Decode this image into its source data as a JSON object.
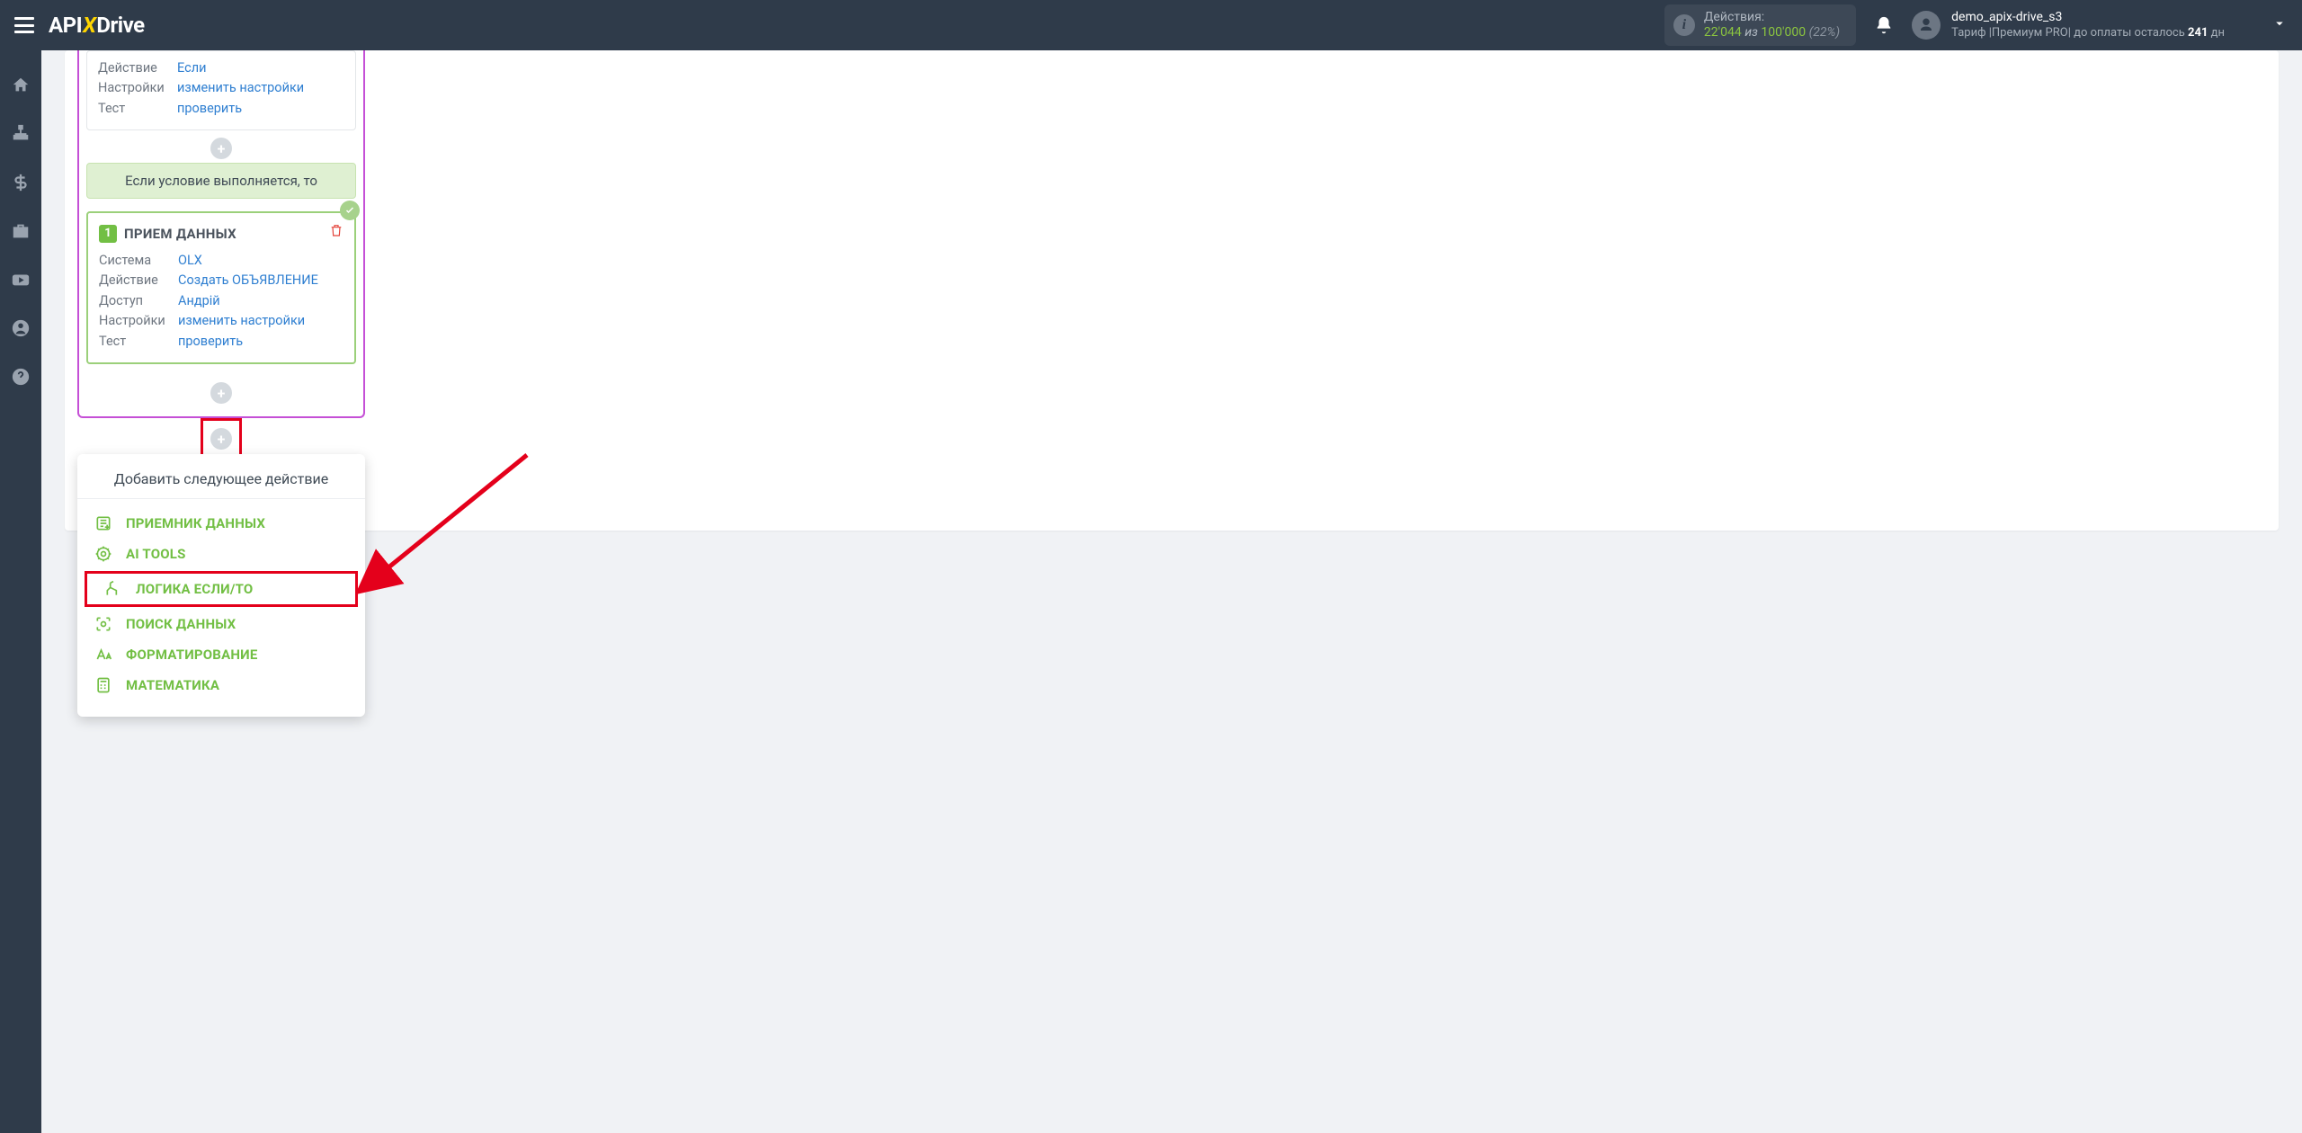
{
  "header": {
    "logo_a": "API",
    "logo_x": "X",
    "logo_b": "Drive",
    "actions_label": "Действия:",
    "actions_used": "22'044",
    "actions_of": "из",
    "actions_total": "100'000",
    "actions_pct": "(22%)",
    "username": "demo_apix-drive_s3",
    "tariff_prefix": "Тариф |",
    "tariff_plan": "Премиум PRO",
    "tariff_mid": "| до оплаты осталось",
    "tariff_days": "241",
    "tariff_suffix": "дн"
  },
  "block1": {
    "r1_lab": "Действие",
    "r1_val": "Если",
    "r2_lab": "Настройки",
    "r2_val": "изменить настройки",
    "r3_lab": "Тест",
    "r3_val": "проверить"
  },
  "cond_text": "Если условие выполняется, то",
  "dest": {
    "badge": "1",
    "title": "ПРИЕМ ДАННЫХ",
    "r1_lab": "Система",
    "r1_val": "OLX",
    "r2_lab": "Действие",
    "r2_val": "Создать ОБЪЯВЛЕНИЕ",
    "r3_lab": "Доступ",
    "r3_val": "Андрій",
    "r4_lab": "Настройки",
    "r4_val": "изменить настройки",
    "r5_lab": "Тест",
    "r5_val": "проверить"
  },
  "dropdown": {
    "title": "Добавить следующее действие",
    "items": [
      "ПРИЕМНИК ДАННЫХ",
      "AI TOOLS",
      "ЛОГИКА ЕСЛИ/ТО",
      "ПОИСК ДАННЫХ",
      "ФОРМАТИРОВАНИЕ",
      "МАТЕМАТИКА"
    ]
  }
}
